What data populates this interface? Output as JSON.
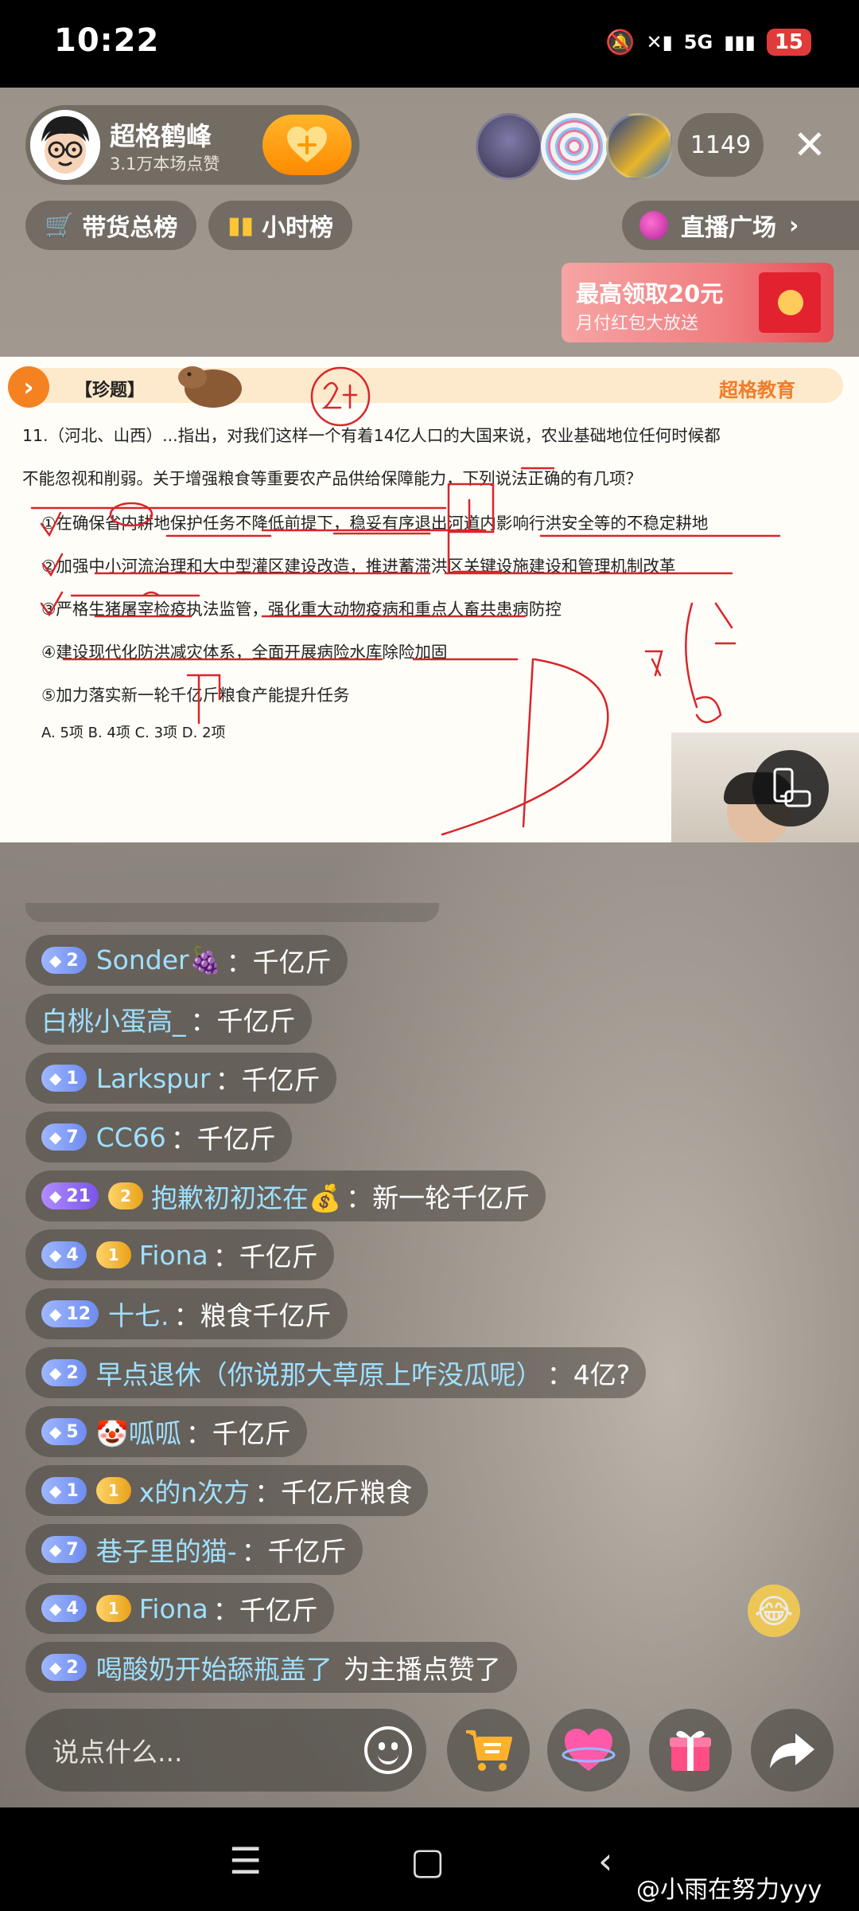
{
  "status_bar": {
    "time": "10:22",
    "signal": "5G",
    "battery": "15"
  },
  "host": {
    "name": "超格鹤峰",
    "likes": "3.1万本场点赞",
    "follow_icon": "heart-plus"
  },
  "viewers": {
    "count": "1149"
  },
  "tabs": {
    "sales_rank": "带货总榜",
    "hour_rank": "小时榜",
    "live_plaza": "直播广场"
  },
  "red_packet": {
    "title": "最高领取20元",
    "subtitle": "月付红包大放送"
  },
  "board": {
    "tag": "【珍题】",
    "logo": "超格教育",
    "question_line1": "11.（河北、山西）...指出，对我们这样一个有着14亿人口的大国来说，农业基础地位任何时候都",
    "question_line2": "不能忽视和削弱。关于增强粮食等重要农产品供给保障能力，下列说法正确的有几项？",
    "options": [
      "①在确保省内耕地保护任务不降低前提下，稳妥有序退出河道内影响行洪安全等的不稳定耕地",
      "②加强中小河流治理和大中型灌区建设改造，推进蓄滞洪区关键设施建设和管理机制改革",
      "③严格生猪屠宰检疫执法监管，强化重大动物疫病和重点人畜共患病防控",
      "④建设现代化防洪减灾体系，全面开展病险水库除险加固",
      "⑤加力落实新一轮千亿斤粮食产能提升任务"
    ],
    "choices": "A. 5项  B. 4项  C. 3项  D. 2项"
  },
  "chat": [
    {
      "level": "2",
      "fan": "",
      "user": "Sonder🍇",
      "text": "千亿斤"
    },
    {
      "level": "",
      "fan": "",
      "user": "白桃小蛋高_",
      "text": "千亿斤"
    },
    {
      "level": "1",
      "fan": "",
      "user": "Larkspur",
      "text": "千亿斤"
    },
    {
      "level": "7",
      "fan": "",
      "user": "CC66",
      "text": "千亿斤"
    },
    {
      "level": "21",
      "fan": "2",
      "user": "抱歉初初还在💰",
      "text": "新一轮千亿斤"
    },
    {
      "level": "4",
      "fan": "1",
      "user": "Fiona",
      "text": "千亿斤"
    },
    {
      "level": "12",
      "fan": "",
      "user": "十七.",
      "text": "粮食千亿斤"
    },
    {
      "level": "2",
      "fan": "",
      "user": "早点退休（你说那大草原上咋没瓜呢）",
      "text": "4亿?"
    },
    {
      "level": "5",
      "fan": "",
      "user": "🤡呱呱",
      "text": "千亿斤"
    },
    {
      "level": "1",
      "fan": "1",
      "user": "x的n次方",
      "text": "千亿斤粮食"
    },
    {
      "level": "7",
      "fan": "",
      "user": "巷子里的猫-",
      "text": "千亿斤"
    },
    {
      "level": "4",
      "fan": "1",
      "user": "Fiona",
      "text": "千亿斤"
    },
    {
      "level": "2",
      "fan": "",
      "user": "喝酸奶开始舔瓶盖了",
      "text": "为主播点赞了"
    }
  ],
  "input": {
    "placeholder": "说点什么..."
  },
  "watermark": "@小雨在努力yyy"
}
